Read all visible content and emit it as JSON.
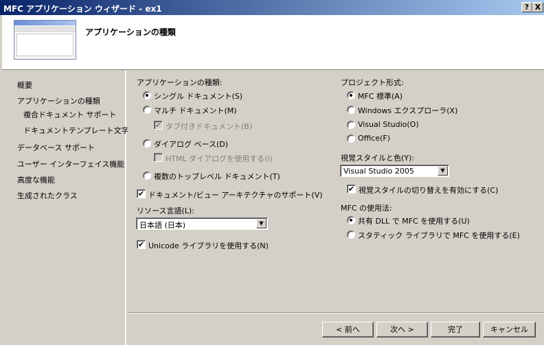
{
  "window": {
    "title": "MFC アプリケーション ウィザード - ex1",
    "help_label": "?",
    "close_label": "X"
  },
  "header": {
    "title": "アプリケーションの種類"
  },
  "nav": [
    "概要",
    "アプリケーションの種類",
    "複合ドキュメント サポート",
    "ドキュメントテンプレート文字列",
    "データベース サポート",
    "ユーザー インターフェイス機能",
    "高度な機能",
    "生成されたクラス"
  ],
  "app_type": {
    "label": "アプリケーションの種類:",
    "single": "シングル ドキュメント(S)",
    "multi": "マルチ ドキュメント(M)",
    "tabbed": "タブ付きドキュメント(B)",
    "dialog": "ダイアログ ベース(D)",
    "html_dialog": "HTML ダイアログを使用する(I)",
    "multi_top": "複数のトップレベル ドキュメント(T)",
    "doc_view": "ドキュメント/ビュー アーキテクチャのサポート(V)",
    "resource_label": "リソース言語(L):",
    "resource_value": "日本語 (日本)",
    "unicode": "Unicode ライブラリを使用する(N)"
  },
  "project": {
    "label": "プロジェクト形式:",
    "mfc": "MFC 標準(A)",
    "explorer": "Windows エクスプローラ(X)",
    "vs": "Visual Studio(O)",
    "office": "Office(F)",
    "style_label": "視覚スタイルと色(Y):",
    "style_value": "Visual Studio 2005",
    "style_switch": "視覚スタイルの切り替えを有効にする(C)"
  },
  "mfc_use": {
    "label": "MFC の使用法:",
    "shared": "共有 DLL で MFC を使用する(U)",
    "static": "スタティック ライブラリで MFC を使用する(E)"
  },
  "buttons": {
    "prev": "< 前へ",
    "next": "次へ >",
    "finish": "完了",
    "cancel": "キャンセル"
  },
  "check_mark": "✔",
  "dropdown_arrow": "▼"
}
